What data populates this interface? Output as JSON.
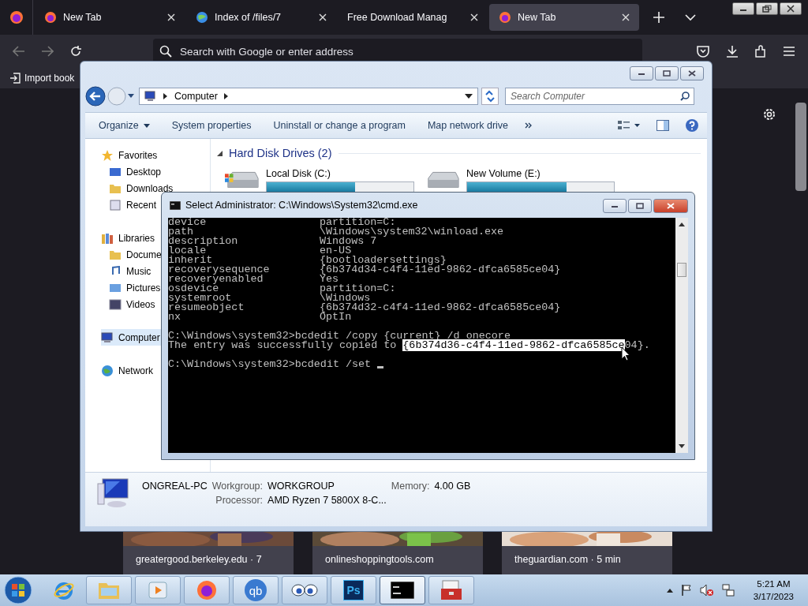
{
  "browser": {
    "tabs": [
      {
        "title": "New Tab",
        "selected": false
      },
      {
        "title": "Index of /files/7",
        "selected": false
      },
      {
        "title": "Free Download Manag",
        "selected": false
      },
      {
        "title": "New Tab",
        "selected": true
      }
    ],
    "address": {
      "placeholder": "Search with Google or enter address"
    },
    "bookmark": "Import book",
    "tiles": [
      {
        "label": "greatergood.berkeley.edu · 7",
        "kind": "picture"
      },
      {
        "label": "onlineshoppingtools.com",
        "kind": "picture"
      },
      {
        "label": "theguardian.com · 5 min",
        "kind": "picture"
      }
    ]
  },
  "explorer": {
    "breadcrumb": "Computer",
    "search": {
      "placeholder": "Search Computer"
    },
    "commands": [
      "Organize",
      "System properties",
      "Uninstall or change a program",
      "Map network drive"
    ],
    "sidebar": [
      {
        "label": "Favorites",
        "selected": false,
        "children": [
          {
            "label": "Desktop",
            "selected": false
          },
          {
            "label": "Downloads",
            "selected": false
          },
          {
            "label": "Recent",
            "selected": false
          }
        ]
      },
      {
        "label": "Libraries",
        "selected": false,
        "children": [
          {
            "label": "Docume",
            "selected": false
          },
          {
            "label": "Music",
            "selected": false
          },
          {
            "label": "Pictures",
            "selected": false
          },
          {
            "label": "Videos",
            "selected": false
          }
        ]
      },
      {
        "label": "Computer",
        "selected": true
      },
      {
        "label": "Network",
        "selected": false
      }
    ],
    "section": "Hard Disk Drives (2)",
    "drives": [
      {
        "name": "Local Disk (C:)",
        "level": 0.6
      },
      {
        "name": "New Volume (E:)",
        "level": 0.68
      }
    ],
    "details": {
      "name": "ONGREAL-PC",
      "fields": [
        {
          "label": "Workgroup:",
          "value": "WORKGROUP"
        },
        {
          "label": "Memory:",
          "value": "4.00 GB"
        },
        {
          "label": "Processor:",
          "value": "AMD Ryzen 7 5800X 8-C..."
        }
      ]
    }
  },
  "cmd": {
    "title": "Select Administrator: C:\\Windows\\System32\\cmd.exe",
    "entries": [
      {
        "key": "device",
        "value": "partition=C:"
      },
      {
        "key": "path",
        "value": "\\Windows\\system32\\winload.exe"
      },
      {
        "key": "description",
        "value": "Windows 7"
      },
      {
        "key": "locale",
        "value": "en-US"
      },
      {
        "key": "inherit",
        "value": "{bootloadersettings}"
      },
      {
        "key": "recoverysequence",
        "value": "{6b374d34-c4f4-11ed-9862-dfca6585ce04}"
      },
      {
        "key": "recoveryenabled",
        "value": "Yes"
      },
      {
        "key": "osdevice",
        "value": "partition=C:"
      },
      {
        "key": "systemroot",
        "value": "\\Windows"
      },
      {
        "key": "resumeobject",
        "value": "{6b374d32-c4f4-11ed-9862-dfca6585ce04}"
      },
      {
        "key": "nx",
        "value": "OptIn"
      }
    ],
    "lines": [
      {
        "before": "C:\\Windows\\system32>bcdedit /copy {current} /d onecore"
      },
      {
        "before": "The entry was successfully copied to ",
        "selection": "{6b374d36-c4f4-11ed-9862-dfca6585ce",
        "after": "04}."
      },
      {
        "before": "C:\\Windows\\system32>bcdedit /set ",
        "cursor": true
      }
    ]
  },
  "taskbar": {
    "apps": [
      {
        "selected": false
      },
      {
        "selected": false
      },
      {
        "selected": false
      },
      {
        "selected": false
      },
      {
        "label": "qb",
        "selected": false
      },
      {
        "selected": false
      },
      {
        "label": "Ps",
        "selected": false
      },
      {
        "selected": true
      },
      {
        "selected": false
      }
    ],
    "time": "5:21 AM",
    "date": "3/17/2023"
  }
}
